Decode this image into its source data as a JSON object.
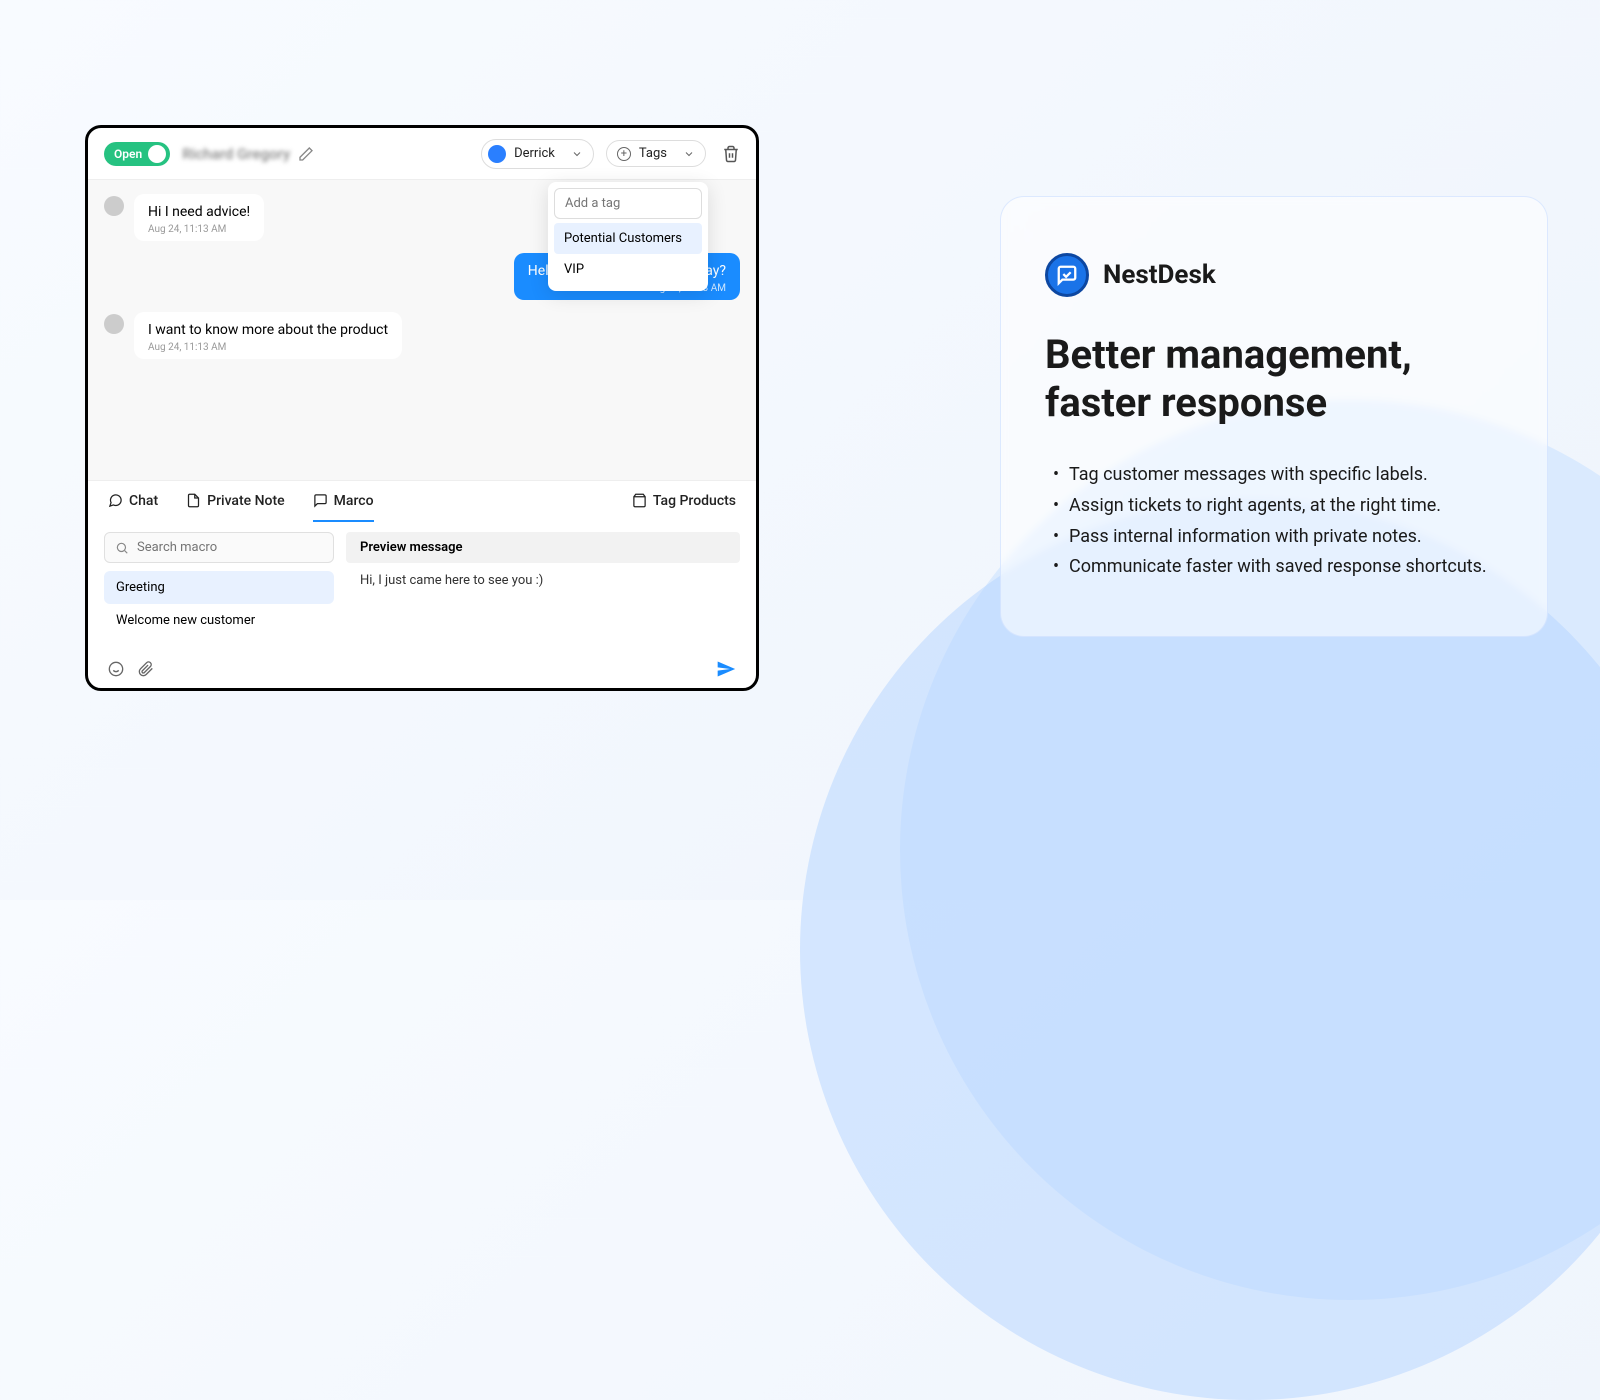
{
  "header": {
    "status": "Open",
    "customer_name": "Richard Gregory",
    "assignee": "Derrick",
    "tags_label": "Tags"
  },
  "tag_dropdown": {
    "placeholder": "Add a tag",
    "options": [
      "Potential Customers",
      "VIP"
    ]
  },
  "messages": [
    {
      "side": "left",
      "text": "Hi I need advice!",
      "time": "Aug 24, 11:13 AM"
    },
    {
      "side": "right",
      "text": "Hello, how can I help you today?",
      "time": "Aug 24, 11:13 AM"
    },
    {
      "side": "left",
      "text": "I want to know more about the product",
      "time": "Aug 24, 11:13 AM"
    }
  ],
  "tabs": {
    "chat": "Chat",
    "private_note": "Private Note",
    "marco": "Marco",
    "tag_products": "Tag Products"
  },
  "macro": {
    "search_placeholder": "Search macro",
    "items": [
      "Greeting",
      "Welcome new customer"
    ],
    "preview_label": "Preview message",
    "preview_text": "Hi, I just came here to see you :)"
  },
  "promo": {
    "brand": "NestDesk",
    "headline": "Better management, faster response",
    "bullets": [
      "Tag customer messages with specific labels.",
      "Assign tickets to right agents, at the right time.",
      "Pass internal information with private notes.",
      "Communicate faster with saved response shortcuts."
    ]
  }
}
